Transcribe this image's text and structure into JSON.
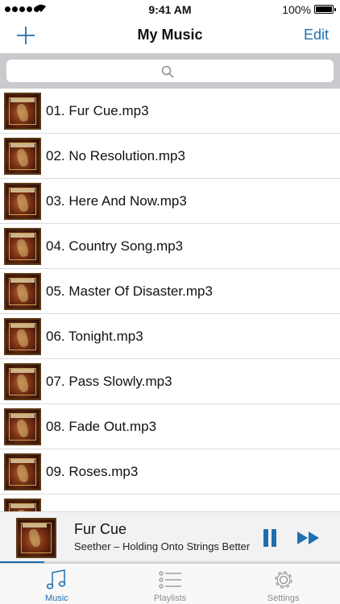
{
  "status_bar": {
    "time": "9:41 AM",
    "battery": "100%"
  },
  "nav": {
    "title": "My Music",
    "add_icon": "plus-icon",
    "edit_label": "Edit"
  },
  "search": {
    "icon": "search-icon"
  },
  "songs": [
    "01. Fur Cue.mp3",
    "02. No Resolution.mp3",
    "03. Here And Now.mp3",
    "04. Country Song.mp3",
    "05. Master Of Disaster.mp3",
    "06. Tonight.mp3",
    "07. Pass Slowly.mp3",
    "08. Fade Out.mp3",
    "09. Roses.mp3",
    ""
  ],
  "now_playing": {
    "title": "Fur Cue",
    "subtitle": "Seether – Holding Onto Strings Better",
    "progress": 0.13,
    "pause_icon": "pause-icon",
    "next_icon": "fast-forward-icon"
  },
  "tabs": [
    {
      "label": "Music",
      "icon": "music-note-icon",
      "active": true
    },
    {
      "label": "Playlists",
      "icon": "list-icon",
      "active": false
    },
    {
      "label": "Settings",
      "icon": "gear-icon",
      "active": false
    }
  ],
  "colors": {
    "accent": "#1f6fae",
    "search_background": "#c9cacd",
    "inactive_tab": "#8e8e93"
  }
}
